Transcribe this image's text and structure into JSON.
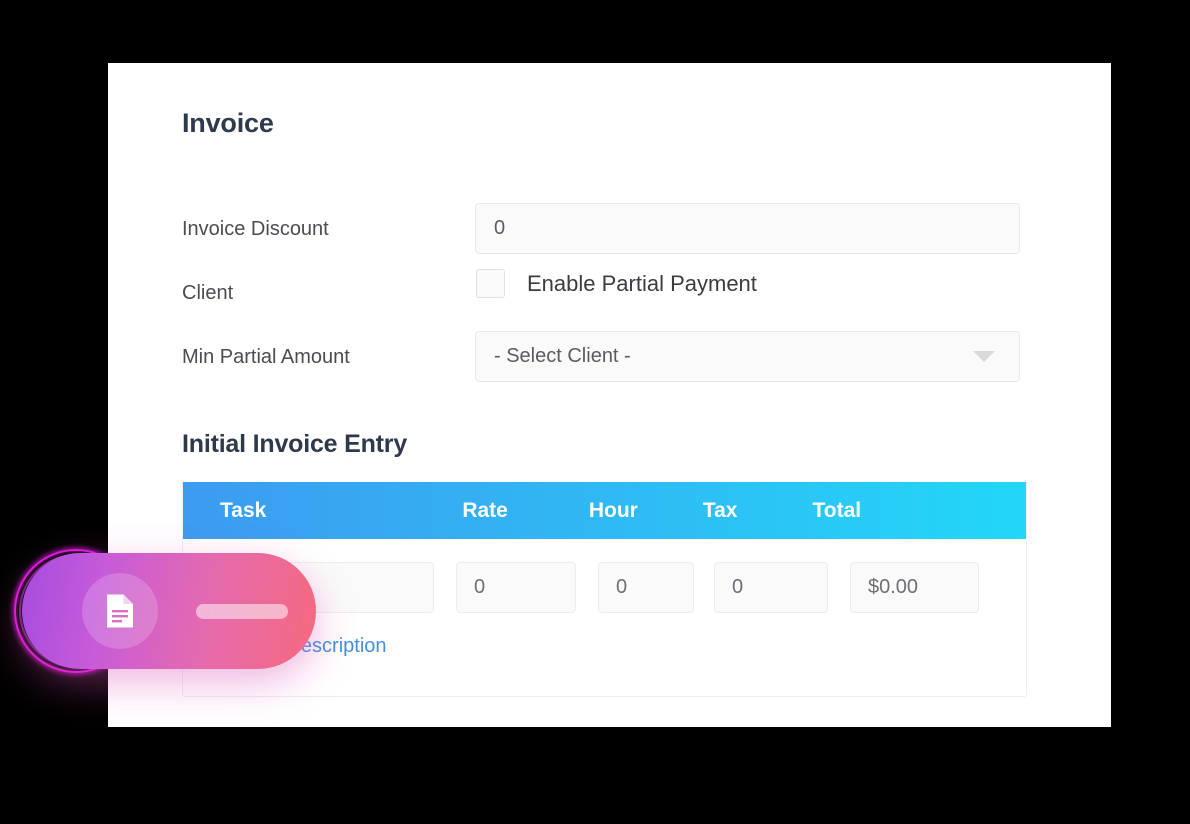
{
  "page": {
    "background_color": "#000000",
    "card_background": "#ffffff",
    "title": "Invoice",
    "section_title": "Initial Invoice Entry",
    "heading_color": "#2e3a4c"
  },
  "form": {
    "rows": [
      {
        "label": "Invoice Discount"
      },
      {
        "label": "Client"
      },
      {
        "label": "Min Partial Amount"
      }
    ],
    "discount_field": {
      "value": "0",
      "placeholder": "0"
    },
    "partial_payment_checkbox": {
      "label": "Enable Partial Payment",
      "checked": false
    },
    "client_select": {
      "value": "- Select Client -",
      "options": [
        "- Select Client -"
      ],
      "caret_icon": "chevron-down-icon"
    }
  },
  "table": {
    "header_gradient_from": "#3d9bf0",
    "header_gradient_to": "#22d7f7",
    "columns": [
      "Task",
      "Rate",
      "Hour",
      "Tax",
      "Total"
    ],
    "row": {
      "task": "",
      "task_placeholder": "",
      "rate": "0",
      "hour": "0",
      "tax": "0",
      "total": "$0.00"
    },
    "toggle_description_label": "Toggle Description",
    "link_color": "#4290e2"
  },
  "floating_widget": {
    "icon": "document-icon",
    "gradient_from": "#a64ce0",
    "gradient_to": "#f6697e",
    "ring_color": "#f618f6"
  }
}
